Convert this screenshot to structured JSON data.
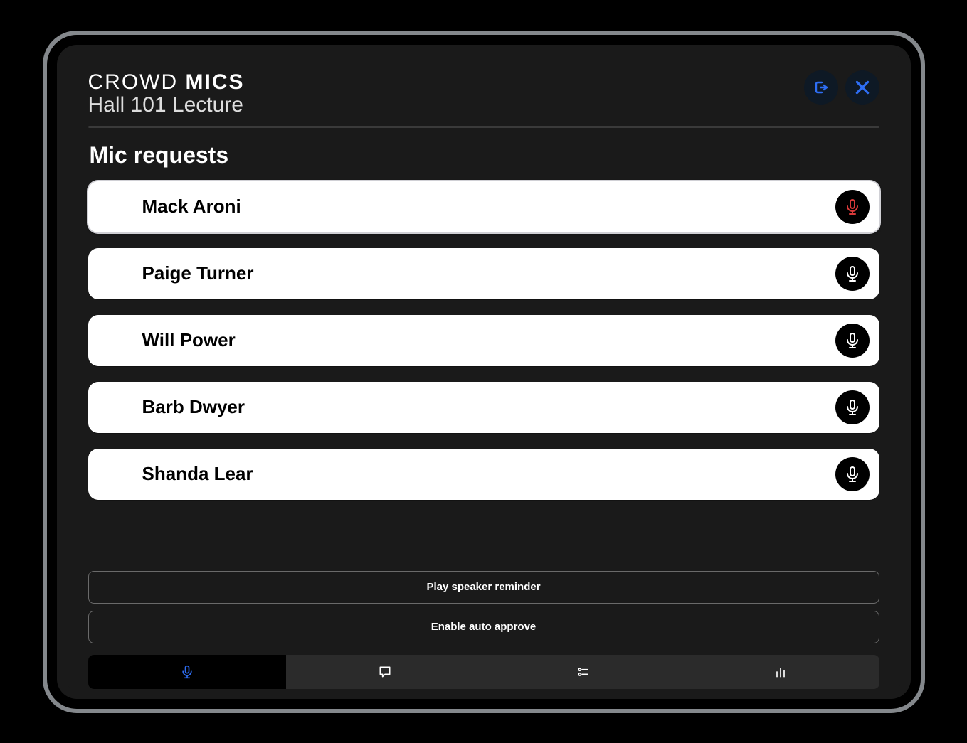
{
  "header": {
    "brand_light": "CROWD",
    "brand_bold": "MICS",
    "subtitle": "Hall 101 Lecture"
  },
  "section_title": "Mic requests",
  "requests": [
    {
      "name": "Mack Aroni",
      "active": true
    },
    {
      "name": "Paige Turner",
      "active": false
    },
    {
      "name": "Will Power",
      "active": false
    },
    {
      "name": "Barb Dwyer",
      "active": false
    },
    {
      "name": "Shanda Lear",
      "active": false
    }
  ],
  "buttons": {
    "reminder": "Play speaker reminder",
    "auto_approve": "Enable auto approve"
  },
  "tabs": {
    "active_index": 0,
    "items": [
      "mic",
      "chat",
      "settings",
      "stats"
    ]
  },
  "colors": {
    "accent": "#2e6ef5",
    "mic_active": "#d93a3a"
  }
}
